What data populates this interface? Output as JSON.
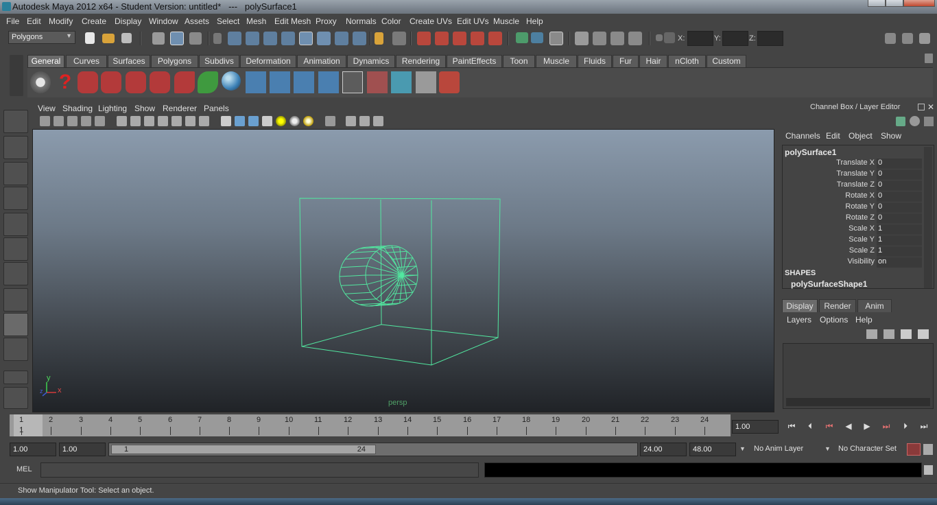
{
  "window": {
    "title": "Autodesk Maya 2012 x64 - Student Version: untitled*   ---   polySurface1"
  },
  "menubar": [
    "File",
    "Edit",
    "Modify",
    "Create",
    "Display",
    "Window",
    "Assets",
    "Select",
    "Mesh",
    "Edit Mesh",
    "Proxy",
    "Normals",
    "Color",
    "Create UVs",
    "Edit UVs",
    "Muscle",
    "Help"
  ],
  "statusline": {
    "mode": "Polygons",
    "x_label": "X:",
    "y_label": "Y:",
    "z_label": "Z:"
  },
  "shelf": {
    "tabs": [
      "General",
      "Curves",
      "Surfaces",
      "Polygons",
      "Subdivs",
      "Deformation",
      "Animation",
      "Dynamics",
      "Rendering",
      "PaintEffects",
      "Toon",
      "Muscle",
      "Fluids",
      "Fur",
      "Hair",
      "nCloth",
      "Custom"
    ],
    "active_tab": "General"
  },
  "panel": {
    "menus": [
      "View",
      "Shading",
      "Lighting",
      "Show",
      "Renderer",
      "Panels"
    ],
    "camera": "persp",
    "axis_y": "y",
    "axis_x": "x",
    "axis_z": "z"
  },
  "channel_box": {
    "header": "Channel Box / Layer Editor",
    "menus": [
      "Channels",
      "Edit",
      "Object",
      "Show"
    ],
    "object": "polySurface1",
    "channels": [
      {
        "name": "Translate X",
        "value": "0"
      },
      {
        "name": "Translate Y",
        "value": "0"
      },
      {
        "name": "Translate Z",
        "value": "0"
      },
      {
        "name": "Rotate X",
        "value": "0"
      },
      {
        "name": "Rotate Y",
        "value": "0"
      },
      {
        "name": "Rotate Z",
        "value": "0"
      },
      {
        "name": "Scale X",
        "value": "1"
      },
      {
        "name": "Scale Y",
        "value": "1"
      },
      {
        "name": "Scale Z",
        "value": "1"
      },
      {
        "name": "Visibility",
        "value": "on"
      }
    ],
    "shapes_label": "SHAPES",
    "shape": "polySurfaceShape1"
  },
  "layer_editor": {
    "tabs": [
      "Display",
      "Render",
      "Anim"
    ],
    "menus": [
      "Layers",
      "Options",
      "Help"
    ]
  },
  "time_slider": {
    "ticks": [
      "1",
      "2",
      "3",
      "4",
      "5",
      "6",
      "7",
      "8",
      "9",
      "10",
      "11",
      "12",
      "13",
      "14",
      "15",
      "16",
      "17",
      "18",
      "19",
      "20",
      "21",
      "22",
      "23",
      "24"
    ],
    "current_frame_label": "1",
    "current_time": "1.00"
  },
  "range_slider": {
    "start": "1.00",
    "playback_start": "1.00",
    "range_start_label": "1",
    "range_end_label": "24",
    "playback_end": "24.00",
    "end": "48.00",
    "anim_layer": "No Anim Layer",
    "character_set": "No Character Set"
  },
  "command_line": {
    "label": "MEL"
  },
  "help_line": {
    "text": "Show Manipulator Tool: Select an object."
  }
}
